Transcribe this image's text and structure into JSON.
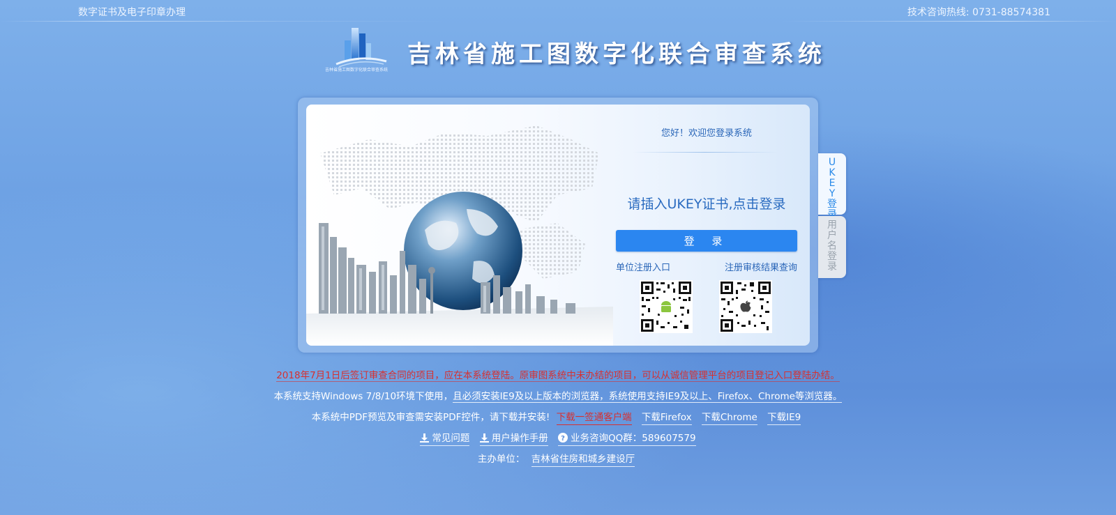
{
  "header": {
    "left_text": "数字证书及电子印章办理",
    "hotline": "技术咨询热线: 0731-88574381"
  },
  "brand": {
    "logo_caption": "吉林省施工图数字化联合审查系统",
    "title": "吉林省施工图数字化联合审查系统"
  },
  "login": {
    "welcome": "您好！欢迎您登录系统",
    "prompt": "请插入UKEY证书,点击登录",
    "button_label": "登 录",
    "register_link": "单位注册入口",
    "query_link": "注册审核结果查询",
    "qr_codes": [
      {
        "icon": "android-icon"
      },
      {
        "icon": "apple-icon"
      }
    ]
  },
  "side_tabs": {
    "ukey": "UKEY登录",
    "username": "用户名登录"
  },
  "notices": {
    "line1": "2018年7月1日后签订审查合同的项目，应在本系统登陆。原审图系统中未办结的项目，可以从诚信管理平台的项目登记入口登陆办结。",
    "line2_a": "本系统支持Windows 7/8/10环境下使用，",
    "line2_b": "且必须安装IE9及以上版本的浏览器，系统使用支持IE9及以上、Firefox、Chrome等浏览器。",
    "line3_text": "本系统中PDF预览及审查需安装PDF控件，请下载并安装!",
    "dl_client": "下载一签通客户端",
    "dl_firefox": "下载Firefox",
    "dl_chrome": "下载Chrome",
    "dl_ie9": "下载IE9",
    "faq": "常见问题",
    "manual": "用户操作手册",
    "qq": "业务咨询QQ群：589607579",
    "host_label": "主办单位：",
    "host_name": "吉林省住房和城乡建设厅"
  },
  "colors": {
    "accent": "#2b86f0",
    "notice_red": "#d63030",
    "link_blue": "#2a66b8"
  }
}
